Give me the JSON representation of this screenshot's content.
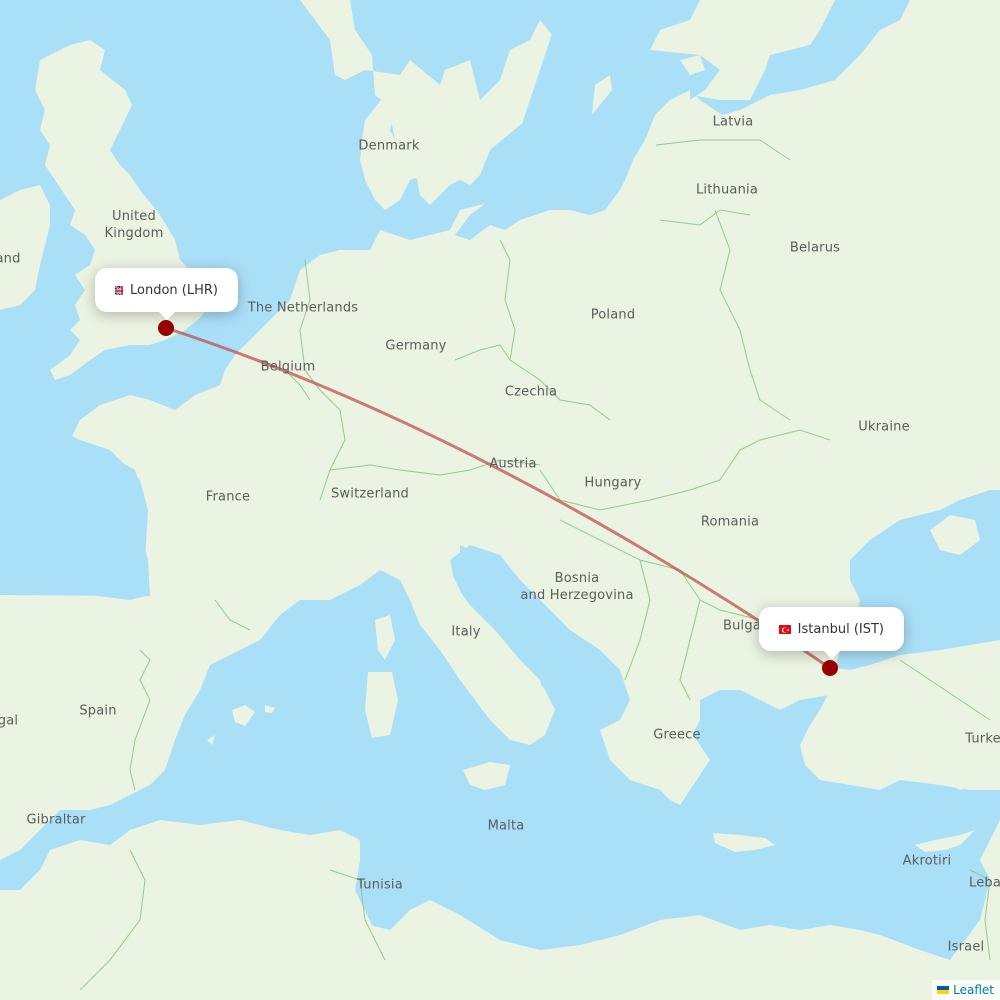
{
  "map": {
    "colors": {
      "water": "#aadff8",
      "land": "#ebf3e2",
      "border": "#8fce8a",
      "route": "#c0504d",
      "marker": "#990000"
    },
    "country_labels": [
      {
        "id": "united-kingdom",
        "lines": [
          "United",
          "Kingdom"
        ]
      },
      {
        "id": "ireland",
        "lines": [
          "and"
        ]
      },
      {
        "id": "denmark",
        "lines": [
          "Denmark"
        ]
      },
      {
        "id": "latvia",
        "lines": [
          "Latvia"
        ]
      },
      {
        "id": "lithuania",
        "lines": [
          "Lithuania"
        ]
      },
      {
        "id": "belarus",
        "lines": [
          "Belarus"
        ]
      },
      {
        "id": "netherlands",
        "lines": [
          "The Netherlands"
        ]
      },
      {
        "id": "germany",
        "lines": [
          "Germany"
        ]
      },
      {
        "id": "poland",
        "lines": [
          "Poland"
        ]
      },
      {
        "id": "belgium",
        "lines": [
          "Belgium"
        ]
      },
      {
        "id": "czechia",
        "lines": [
          "Czechia"
        ]
      },
      {
        "id": "ukraine",
        "lines": [
          "Ukraine"
        ]
      },
      {
        "id": "austria",
        "lines": [
          "Austria"
        ]
      },
      {
        "id": "france",
        "lines": [
          "France"
        ]
      },
      {
        "id": "switzerland",
        "lines": [
          "Switzerland"
        ]
      },
      {
        "id": "hungary",
        "lines": [
          "Hungary"
        ]
      },
      {
        "id": "romania",
        "lines": [
          "Romania"
        ]
      },
      {
        "id": "bosnia",
        "lines": [
          "Bosnia",
          "and Herzegovina"
        ]
      },
      {
        "id": "italy",
        "lines": [
          "Italy"
        ]
      },
      {
        "id": "bulgaria",
        "lines": [
          "Bulga"
        ]
      },
      {
        "id": "portugal",
        "lines": [
          "gal"
        ]
      },
      {
        "id": "spain",
        "lines": [
          "Spain"
        ]
      },
      {
        "id": "greece",
        "lines": [
          "Greece"
        ]
      },
      {
        "id": "turkey",
        "lines": [
          "Turke"
        ]
      },
      {
        "id": "gibraltar",
        "lines": [
          "Gibraltar"
        ]
      },
      {
        "id": "malta",
        "lines": [
          "Malta"
        ]
      },
      {
        "id": "tunisia",
        "lines": [
          "Tunisia"
        ]
      },
      {
        "id": "akrotiri",
        "lines": [
          "Akrotiri"
        ]
      },
      {
        "id": "lebanon",
        "lines": [
          "Leba"
        ]
      },
      {
        "id": "israel",
        "lines": [
          "Israel"
        ]
      }
    ],
    "route": {
      "origin": {
        "city": "London",
        "code": "LHR",
        "label": "London (LHR)",
        "flag": "gb-flag"
      },
      "destination": {
        "city": "Istanbul",
        "code": "IST",
        "label": "Istanbul (IST)",
        "flag": "tr-flag"
      }
    },
    "attribution": {
      "label": "Leaflet",
      "icon": "ukraine-flag-icon"
    }
  }
}
